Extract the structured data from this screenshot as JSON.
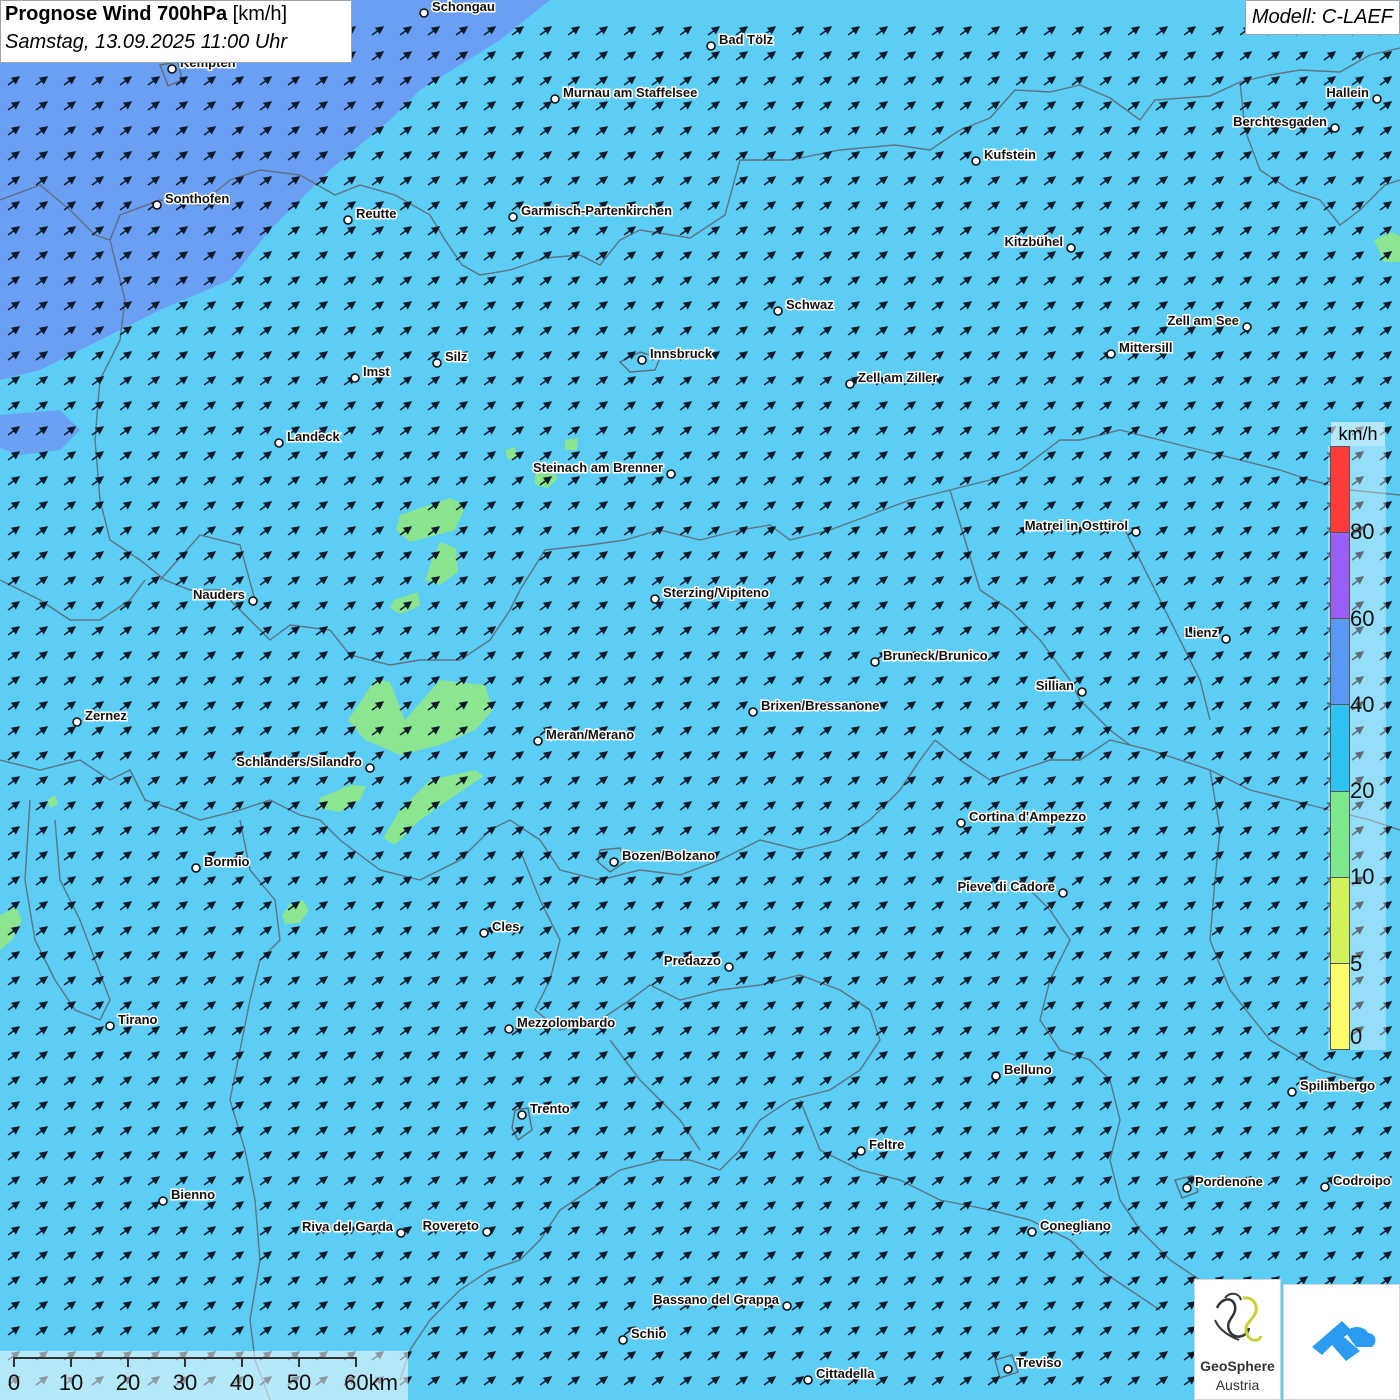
{
  "title": {
    "main": "Prognose Wind 700hPa",
    "unit": "[km/h]",
    "datetime": "Samstag, 13.09.2025 11:00 Uhr"
  },
  "model": "Modell: C-LAEF",
  "legend": {
    "unit": "km/h",
    "labels": [
      "80",
      "60",
      "40",
      "20",
      "10",
      "5",
      "0"
    ],
    "colors": [
      "#ff3b3b",
      "#9b5ff5",
      "#5a98f5",
      "#2fc3f3",
      "#7ee88e",
      "#d2f35a",
      "#ffff6e"
    ]
  },
  "scale": {
    "labels": [
      "0",
      "10",
      "20",
      "30",
      "40",
      "50",
      "60km"
    ]
  },
  "cities": [
    {
      "name": "Schongau"
    },
    {
      "name": "Bad Tölz"
    },
    {
      "name": "Kempten"
    },
    {
      "name": "Murnau am Staffelsee"
    },
    {
      "name": "Hallein"
    },
    {
      "name": "Berchtesgaden"
    },
    {
      "name": "Kufstein"
    },
    {
      "name": "Sonthofen"
    },
    {
      "name": "Reutte"
    },
    {
      "name": "Garmisch-Partenkirchen"
    },
    {
      "name": "Kitzbühel"
    },
    {
      "name": "Schwaz"
    },
    {
      "name": "Zell am See"
    },
    {
      "name": "Mittersill"
    },
    {
      "name": "Imst"
    },
    {
      "name": "Silz"
    },
    {
      "name": "Innsbruck"
    },
    {
      "name": "Zell am Ziller"
    },
    {
      "name": "Landeck"
    },
    {
      "name": "Steinach am Brenner"
    },
    {
      "name": "Matrei in Osttirol"
    },
    {
      "name": "Nauders"
    },
    {
      "name": "Sterzing/Vipiteno"
    },
    {
      "name": "Lienz"
    },
    {
      "name": "Bruneck/Brunico"
    },
    {
      "name": "Sillian"
    },
    {
      "name": "Zernez"
    },
    {
      "name": "Brixen/Bressanone"
    },
    {
      "name": "Meran/Merano"
    },
    {
      "name": "Schlanders/Silandro"
    },
    {
      "name": "Cortina d'Ampezzo"
    },
    {
      "name": "Bozen/Bolzano"
    },
    {
      "name": "Bormio"
    },
    {
      "name": "Pieve di Cadore"
    },
    {
      "name": "Cles"
    },
    {
      "name": "Predazzo"
    },
    {
      "name": "Tirano"
    },
    {
      "name": "Mezzolombardo"
    },
    {
      "name": "Belluno"
    },
    {
      "name": "Spilimbergo"
    },
    {
      "name": "Trento"
    },
    {
      "name": "Feltre"
    },
    {
      "name": "Pordenone"
    },
    {
      "name": "Codroipo"
    },
    {
      "name": "Bienno"
    },
    {
      "name": "Riva del Garda"
    },
    {
      "name": "Rovereto"
    },
    {
      "name": "Conegliano"
    },
    {
      "name": "Bassano del Grappa"
    },
    {
      "name": "Schio"
    },
    {
      "name": "Treviso"
    },
    {
      "name": "Cittadella"
    }
  ],
  "logos": {
    "geosphere_name": "GeoSphere",
    "geosphere_country": "Austria",
    "geosphere_icon": "geosphere-logo-icon",
    "app_icon": "app-arrow-icon"
  },
  "colors": {
    "wind_20_40": "#5ccdf5",
    "wind_40_60": "#6b9cf2",
    "wind_10_20": "#8ee68a",
    "border": "#5d6a76",
    "arrow": "#0d1a2a"
  }
}
